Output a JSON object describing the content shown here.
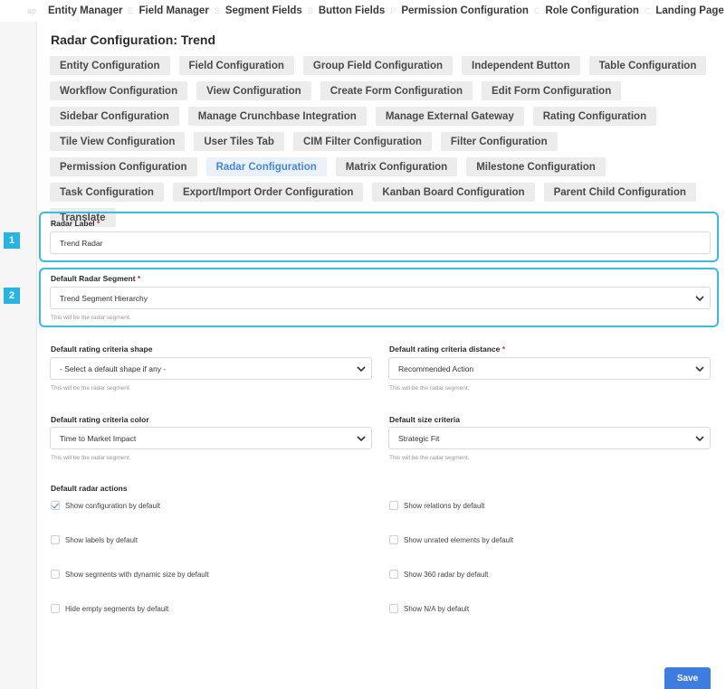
{
  "topnav": {
    "ghost_left": "ap",
    "items": [
      "Entity Manager",
      "Field Manager",
      "Segment Fields",
      "Button Fields",
      "Permission Configuration",
      "Role Configuration",
      "Landing Page Configuration"
    ],
    "separators": [
      "E",
      "S",
      "B",
      "P",
      "C",
      "C"
    ]
  },
  "page_title": "Radar Configuration: Trend",
  "tabs": [
    "Entity Configuration",
    "Field Configuration",
    "Group Field Configuration",
    "Independent Button",
    "Table Configuration",
    "Workflow Configuration",
    "View Configuration",
    "Create Form Configuration",
    "Edit Form Configuration",
    "Sidebar Configuration",
    "Manage Crunchbase Integration",
    "Manage External Gateway",
    "Rating Configuration",
    "Tile View Configuration",
    "User Tiles Tab",
    "CIM Filter Configuration",
    "Filter Configuration",
    "Permission Configuration",
    "Radar Configuration",
    "Matrix Configuration",
    "Milestone Configuration",
    "Task Configuration",
    "Export/Import Order Configuration",
    "Kanban Board Configuration",
    "Parent Child Configuration",
    "Translate"
  ],
  "active_tab": "Radar Configuration",
  "markers": [
    "1",
    "2"
  ],
  "form": {
    "radar_label": {
      "label": "Radar Label",
      "required": "*",
      "value": "Trend Radar"
    },
    "default_segment": {
      "label": "Default Radar Segment",
      "required": "*",
      "value": "Trend Segment Hierarchy",
      "hint": "This will be the radar segment."
    },
    "shape": {
      "label": "Default rating criteria shape",
      "value": "- Select a default shape if any -",
      "hint": "This will be the radar segment."
    },
    "distance": {
      "label": "Default rating criteria distance",
      "required": "*",
      "value": "Recommended Action",
      "hint": "This will be the radar segment."
    },
    "color": {
      "label": "Default rating criteria color",
      "value": "Time to Market Impact",
      "hint": "This will be the radar segment."
    },
    "size": {
      "label": "Default size criteria",
      "value": "Strategic Fit",
      "hint": "This will be the radar segment."
    }
  },
  "actions": {
    "title": "Default radar actions",
    "items": [
      {
        "label": "Show configuration by default",
        "checked": true
      },
      {
        "label": "Show relations by default",
        "checked": false
      },
      {
        "label": "Show labels by default",
        "checked": false
      },
      {
        "label": "Show unrated elements by default",
        "checked": false
      },
      {
        "label": "Show segments with dynamic size by default",
        "checked": false
      },
      {
        "label": "Show 360 radar by default",
        "checked": false
      },
      {
        "label": "Hide empty segments by default",
        "checked": false
      },
      {
        "label": "Show N/A by default",
        "checked": false
      }
    ]
  },
  "save_label": "Save",
  "colors": {
    "accent": "#3d7de0",
    "highlight": "#3bbcdf",
    "marker": "#29b3e0",
    "required": "#d9302c"
  }
}
